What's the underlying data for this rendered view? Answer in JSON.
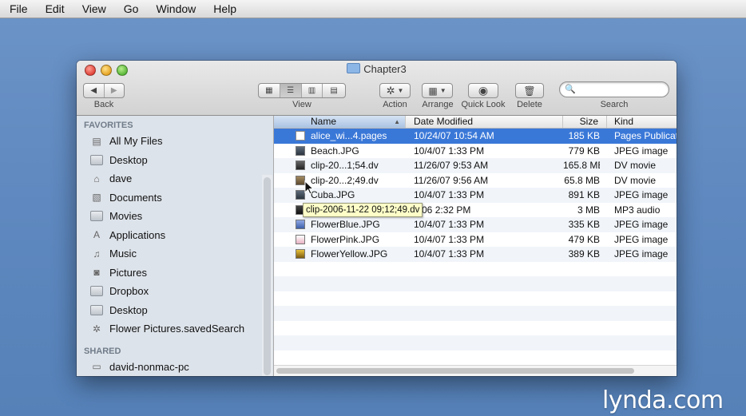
{
  "menubar": {
    "items": [
      "File",
      "Edit",
      "View",
      "Go",
      "Window",
      "Help"
    ]
  },
  "window": {
    "title": "Chapter3",
    "toolbar": {
      "back_label": "Back",
      "view_label": "View",
      "action_label": "Action",
      "arrange_label": "Arrange",
      "quicklook_label": "Quick Look",
      "delete_label": "Delete",
      "search_label": "Search",
      "search_placeholder": ""
    }
  },
  "sidebar": {
    "favorites_header": "FAVORITES",
    "items": [
      {
        "label": "All My Files",
        "icon": "all-files-icon"
      },
      {
        "label": "Desktop",
        "icon": "folder-icon"
      },
      {
        "label": "dave",
        "icon": "home-icon"
      },
      {
        "label": "Documents",
        "icon": "documents-icon"
      },
      {
        "label": "Movies",
        "icon": "folder-icon"
      },
      {
        "label": "Applications",
        "icon": "applications-icon"
      },
      {
        "label": "Music",
        "icon": "music-icon"
      },
      {
        "label": "Pictures",
        "icon": "pictures-icon"
      },
      {
        "label": "Dropbox",
        "icon": "folder-icon"
      },
      {
        "label": "Desktop",
        "icon": "folder-icon"
      },
      {
        "label": "Flower Pictures.savedSearch",
        "icon": "gear-icon"
      }
    ],
    "shared_header": "SHARED",
    "shared_items": [
      {
        "label": "david-nonmac-pc",
        "icon": "pc-icon"
      }
    ]
  },
  "filelist": {
    "columns": {
      "name": "Name",
      "date": "Date Modified",
      "size": "Size",
      "kind": "Kind"
    },
    "rows": [
      {
        "name": "alice_wi...4.pages",
        "date": "10/24/07 10:54 AM",
        "size": "185 KB",
        "kind": "Pages Publicat",
        "selected": true
      },
      {
        "name": "Beach.JPG",
        "date": "10/4/07 1:33 PM",
        "size": "779 KB",
        "kind": "JPEG image"
      },
      {
        "name": "clip-20...1;54.dv",
        "date": "11/26/07 9:53 AM",
        "size": "165.8 MB",
        "kind": "DV movie"
      },
      {
        "name": "clip-20...2;49.dv",
        "date": "11/26/07 9:56 AM",
        "size": "65.8 MB",
        "kind": "DV movie"
      },
      {
        "name": "Cuba.JPG",
        "date": "10/4/07 1:33 PM",
        "size": "891 KB",
        "kind": "JPEG image"
      },
      {
        "name": "",
        "date": "9/06 2:32 PM",
        "size": "3 MB",
        "kind": "MP3 audio"
      },
      {
        "name": "FlowerBlue.JPG",
        "date": "10/4/07 1:33 PM",
        "size": "335 KB",
        "kind": "JPEG image"
      },
      {
        "name": "FlowerPink.JPG",
        "date": "10/4/07 1:33 PM",
        "size": "479 KB",
        "kind": "JPEG image"
      },
      {
        "name": "FlowerYellow.JPG",
        "date": "10/4/07 1:33 PM",
        "size": "389 KB",
        "kind": "JPEG image"
      }
    ],
    "tooltip": "clip-2006-11-22 09;12;49.dv"
  },
  "watermark": "lynda.com"
}
